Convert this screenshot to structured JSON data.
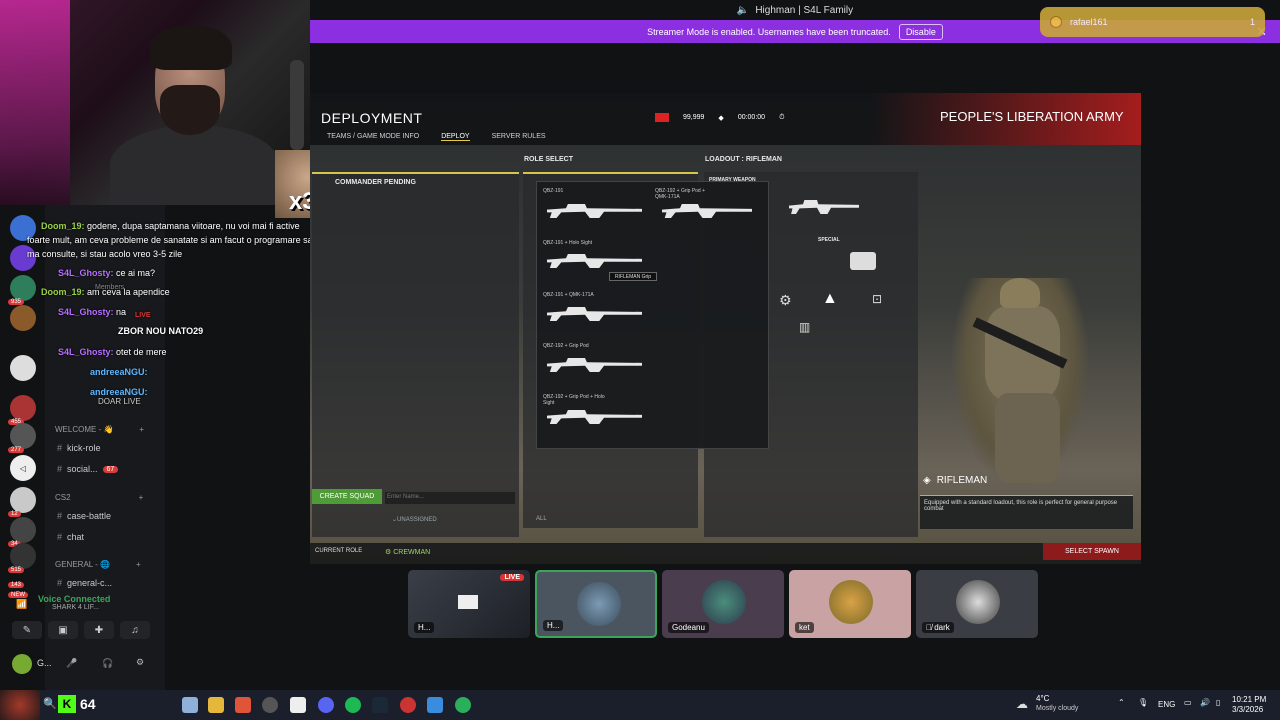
{
  "window": {
    "title": "Highman | S4L Family"
  },
  "streamer": {
    "message": "Streamer Mode is enabled. Usernames have been truncated.",
    "disable_label": "Disable"
  },
  "toast": {
    "user": "rafael161",
    "count": "1"
  },
  "cam_meme": {
    "text": "x3"
  },
  "chat": {
    "messages": [
      {
        "user": "Doom_19:",
        "text": "godene, dupa saptamana viitoare, nu voi mai fi active"
      },
      {
        "user": "",
        "text": "foarte mult, am ceva probleme de sanatate si am facut o programare sa"
      },
      {
        "user": "",
        "text": "ma consulte, si stau acolo vreo 3-5 zile"
      },
      {
        "user": "S4L_Ghosty:",
        "text": "ce ai ma?"
      },
      {
        "user": "Doom_19:",
        "text": "am ceva la apendice"
      },
      {
        "user": "S4L_Ghosty:",
        "text": "na"
      },
      {
        "user": "",
        "text": "ZBOR NOU NATO29"
      },
      {
        "user": "S4L_Ghosty:",
        "text": "otet de mere"
      },
      {
        "user": "andreeaNGU:",
        "text": ""
      },
      {
        "user": "andreeaNGU:",
        "text": ""
      }
    ],
    "overlay_texts": [
      "Members",
      "LIVE",
      "DOAR LIVE"
    ]
  },
  "servers": {
    "badges": [
      "277",
      "12",
      "34",
      "515",
      "143",
      "NEW",
      "935",
      "455"
    ]
  },
  "channels": {
    "categories": [
      {
        "label": "WELCOME - 👋"
      },
      {
        "label": "CS2"
      },
      {
        "label": "GENERAL - 🌐"
      }
    ],
    "items": [
      {
        "label": "kick-role"
      },
      {
        "label": "social...",
        "badge": "67"
      },
      {
        "label": "case-battle"
      },
      {
        "label": "chat"
      },
      {
        "label": "general-c..."
      }
    ]
  },
  "voice": {
    "status": "Voice Connected",
    "server": "SHARK 4 LIF...",
    "user": "G..."
  },
  "game": {
    "title": "DEPLOYMENT",
    "tabs": [
      "TEAMS / GAME MODE INFO",
      "DEPLOY",
      "SERVER RULES"
    ],
    "tickets": "99,999",
    "timer": "00:00:00",
    "faction": "PEOPLE'S LIBERATION ARMY",
    "commander": "COMMANDER PENDING",
    "role_select": "ROLE SELECT",
    "loadout": "LOADOUT : RIFLEMAN",
    "primary_weapon": "PRIMARY WEAPON",
    "special": "SPECIAL",
    "weapons": [
      "QBZ-191",
      "QBZ-192 + Grip Pod + QMK-171A",
      "QBZ-191 + Holo Sight",
      "QBZ-191 + QMK-171A",
      "QBZ-192 + Grip Pod",
      "QBZ-192 + Grip Pod + Holo Sight"
    ],
    "tooltip": "RIFLEMAN Grip",
    "create_squad": "CREATE SQUAD",
    "enter_name": "Enter Name...",
    "unassigned": "UNASSIGNED",
    "all": "ALL",
    "current_role": "CURRENT ROLE",
    "crewman": "CREWMAN",
    "select_spawn": "SELECT SPAWN",
    "role_name": "RIFLEMAN",
    "role_desc": "Equipped with a standard loadout, this role is perfect for general purpose combat"
  },
  "participants": [
    {
      "name": "H...",
      "live": "LIVE"
    },
    {
      "name": "H..."
    },
    {
      "name": "Godeanu"
    },
    {
      "name": "ket"
    },
    {
      "name": "dark"
    }
  ],
  "taskbar": {
    "kick_count": "64",
    "weather_temp": "4°C",
    "weather_desc": "Mostly cloudy",
    "lang": "ENG",
    "time": "10:21 PM",
    "date": "3/3/2026"
  },
  "colors": {
    "accent_purple": "#8c2fe0",
    "kick_green": "#53fc18",
    "live_red": "#d83636"
  }
}
